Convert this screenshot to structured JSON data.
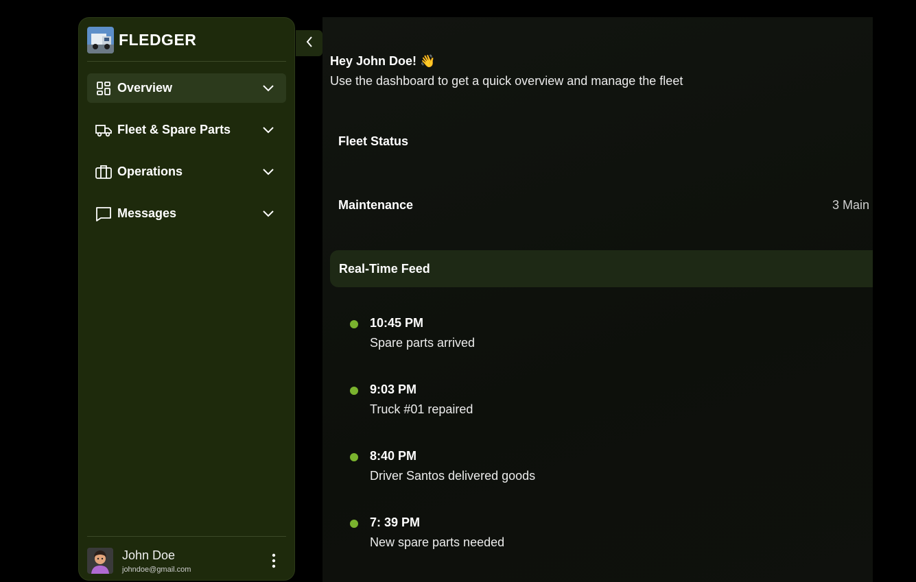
{
  "app": {
    "name": "FLEDGER"
  },
  "sidebar": {
    "items": [
      {
        "label": "Overview",
        "icon": "grid-icon",
        "active": true
      },
      {
        "label": "Fleet & Spare Parts",
        "icon": "truck-icon"
      },
      {
        "label": "Operations",
        "icon": "briefcase-icon"
      },
      {
        "label": "Messages",
        "icon": "message-icon"
      }
    ]
  },
  "user": {
    "name": "John Doe",
    "email": "johndoe@gmail.com"
  },
  "main": {
    "greeting": "Hey John Doe! 👋",
    "subtitle": "Use the dashboard to get a quick overview and manage the fleet",
    "fleet_status_label": "Fleet Status",
    "maintenance_label": "Maintenance",
    "maintenance_count": "3 Main",
    "feed_title": "Real-Time Feed",
    "feed": [
      {
        "time": "10:45 PM",
        "text": "Spare parts arrived"
      },
      {
        "time": "9:03 PM",
        "text": "Truck #01 repaired"
      },
      {
        "time": "8:40 PM",
        "text": "Driver Santos delivered goods"
      },
      {
        "time": "7: 39 PM",
        "text": "New spare parts needed"
      }
    ]
  },
  "colors": {
    "accent": "#7ab32e",
    "sidebar_bg": "#1e2a0c",
    "active_bg": "#2c3a1c"
  }
}
